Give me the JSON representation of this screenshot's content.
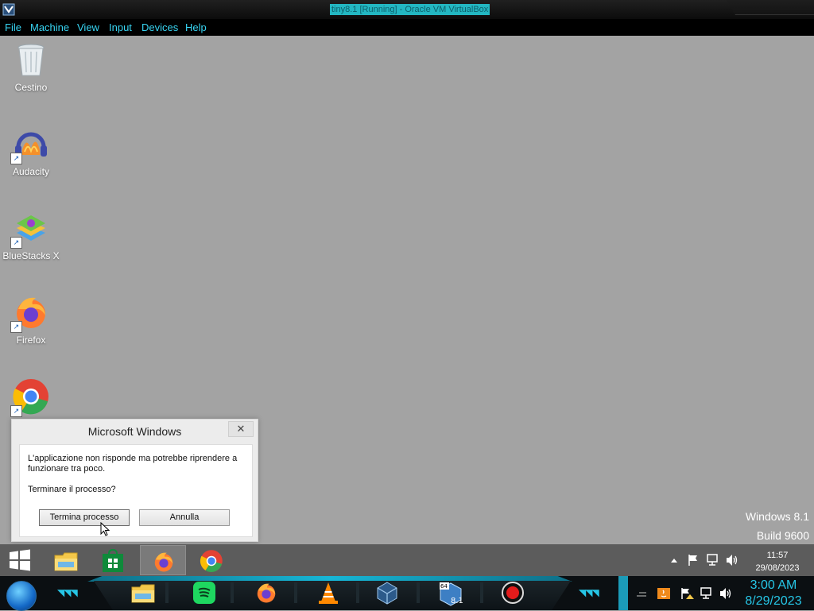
{
  "host": {
    "window_title": "tiny8.1 [Running] - Oracle VM VirtualBox",
    "menu": [
      "File",
      "Machine",
      "View",
      "Input",
      "Devices",
      "Help"
    ],
    "clock_time": "3:00 AM",
    "clock_date": "8/29/2023",
    "accent_color": "#26c6e6"
  },
  "desktop": {
    "icons": [
      {
        "label": "Cestino",
        "icon": "recycle-bin-icon"
      },
      {
        "label": "Audacity",
        "icon": "audacity-icon"
      },
      {
        "label": "BlueStacks X",
        "icon": "bluestacks-icon"
      },
      {
        "label": "Firefox",
        "icon": "firefox-icon"
      },
      {
        "label": "",
        "icon": "chrome-icon"
      }
    ],
    "watermark_line1": "Windows 8.1",
    "watermark_line2": "Build 9600"
  },
  "dialog": {
    "title": "Microsoft Windows",
    "close_glyph": "✕",
    "message": "L'applicazione non risponde ma potrebbe riprendere a funzionare tra poco.",
    "question": "Terminare il processo?",
    "primary_button": "Termina processo",
    "secondary_button": "Annulla"
  },
  "taskbar": {
    "apps": [
      "file-explorer-icon",
      "store-icon",
      "firefox-icon",
      "chrome-icon"
    ],
    "clock_time": "11:57",
    "clock_date": "29/08/2023"
  }
}
